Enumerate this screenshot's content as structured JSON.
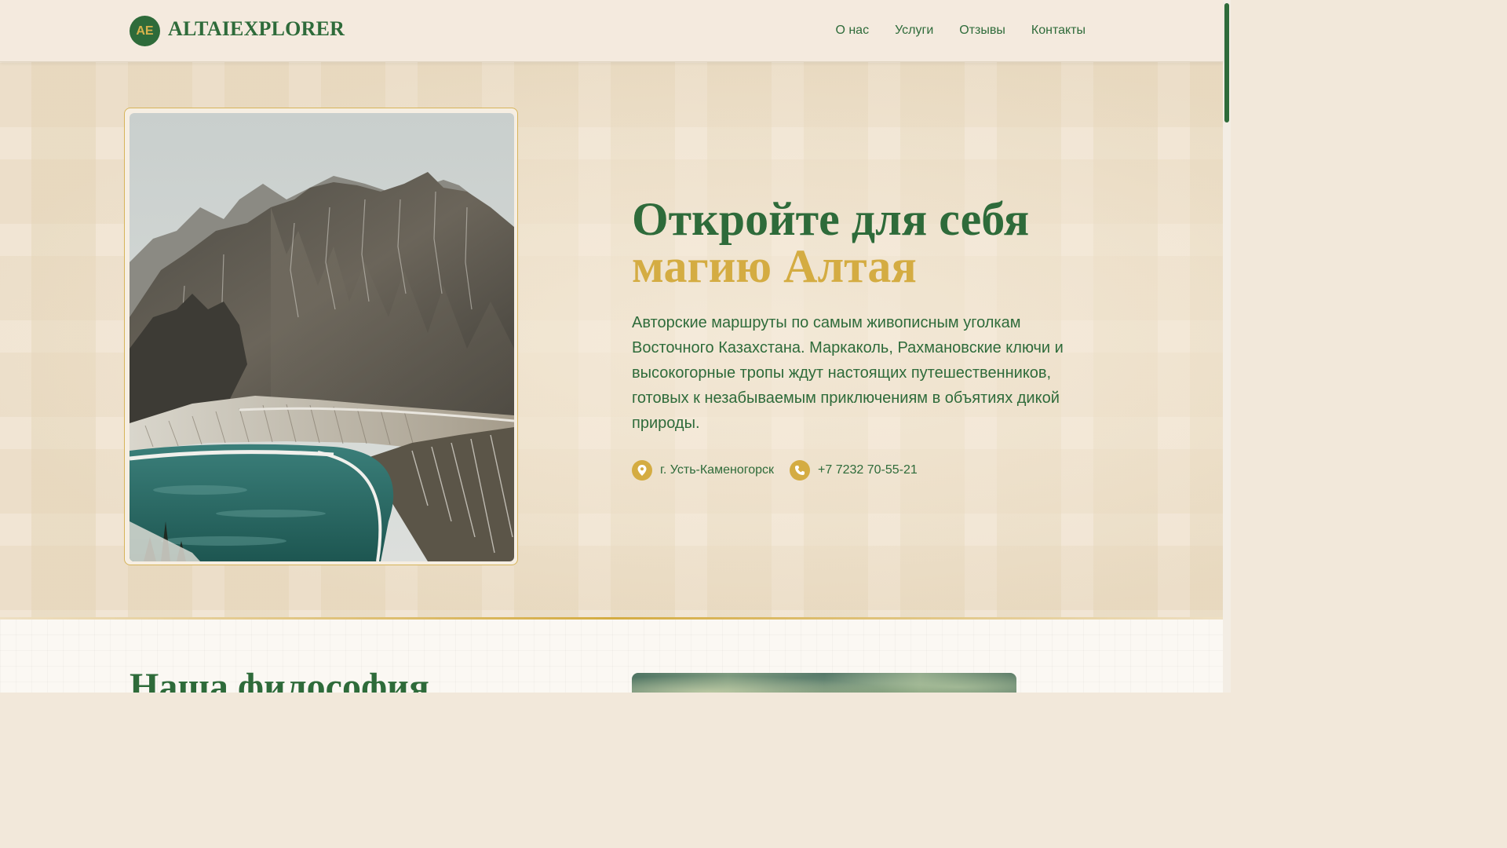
{
  "header": {
    "logo_badge": "AE",
    "logo_text": "ALTAIEXPLORER",
    "nav": [
      "О нас",
      "Услуги",
      "Отзывы",
      "Контакты"
    ]
  },
  "hero": {
    "title_line1": "Откройте для себя",
    "title_line2": "магию Алтая",
    "description": "Авторские маршруты по самым живописным уголкам Восточного Казахстана. Маркаколь, Рахмановские ключи и высокогорные тропы ждут настоящих путешественников, готовых к незабываемым приключениям в объятиях дикой природы.",
    "location": "г. Усть-Каменогорск",
    "phone": "+7 7232 70-55-21",
    "location_icon": "location-pin-icon",
    "phone_icon": "phone-icon"
  },
  "section2": {
    "title": "Наша философия"
  },
  "colors": {
    "green": "#2e6b3a",
    "gold": "#d4ac42",
    "background": "#f2e8da"
  }
}
